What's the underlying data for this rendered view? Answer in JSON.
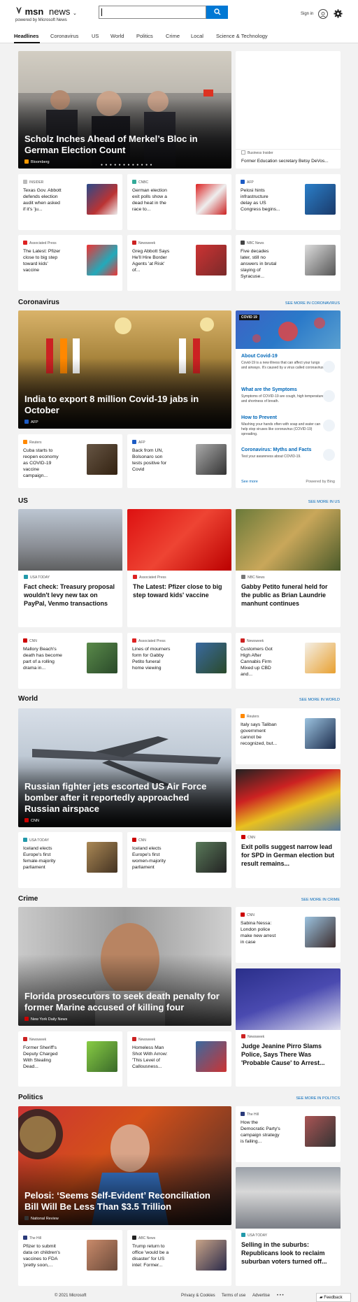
{
  "header": {
    "logo": "msn",
    "product": "news",
    "powered_by": "powered by Microsoft News",
    "search_placeholder": "",
    "signin": "Sign in"
  },
  "nav": [
    "Headlines",
    "Coronavirus",
    "US",
    "World",
    "Politics",
    "Crime",
    "Local",
    "Science & Technology"
  ],
  "headlines": {
    "hero": {
      "title": "Scholz Inches Ahead of Merkel’s Bloc in German Election Count",
      "source": "Bloomberg"
    },
    "side": {
      "source": "Business Insider",
      "title": "Former Education secretary Betsy DeVos..."
    },
    "cards": [
      {
        "source": "INSIDER",
        "title": "Texas Gov. Abbott defends election audit when asked if it's 'ju..."
      },
      {
        "source": "CNBC",
        "title": "German election exit polls show a dead heat in the race to..."
      },
      {
        "source": "AFP",
        "title": "Pelosi hints infrastructure delay as US Congress begins..."
      },
      {
        "source": "Associated Press",
        "title": "The Latest: Pfizer close to big step toward kids' vaccine"
      },
      {
        "source": "Newsweek",
        "title": "Greg Abbott Says He'll Hire Border Agents 'at Risk' of..."
      },
      {
        "source": "NBC News",
        "title": "Five decades later, still no answers in brutal slaying of Syracuse..."
      }
    ]
  },
  "coronavirus": {
    "heading": "Coronavirus",
    "see_more": "SEE MORE IN CORONAVIRUS",
    "hero": {
      "title": "India to export 8 million Covid-19 jabs in October",
      "source": "AFP"
    },
    "cards": [
      {
        "source": "Reuters",
        "title": "Cuba starts to reopen economy as COVID-19 vaccine campaign..."
      },
      {
        "source": "AFP",
        "title": "Back from UN, Bolsonaro son tests positive for Covid"
      }
    ],
    "panel": {
      "tag": "COVID 19",
      "items": [
        {
          "title": "About Covid-19",
          "desc": "Covid-19 is a new illness that can affect your lungs and airways. It's caused by a virus called coronavirus."
        },
        {
          "title": "What are the Symptoms",
          "desc": "Symptoms of COVID-19 are cough, high temperature and shortness of breath."
        },
        {
          "title": "How to Prevent",
          "desc": "Washing your hands often with soap and water can help stop viruses like coronavirus (COVID-19) spreading."
        },
        {
          "title": "Coronavirus: Myths and Facts",
          "desc": "Test your awareness about COVID-19."
        }
      ],
      "see_more": "See more",
      "powered": "Powered by Bing"
    }
  },
  "us": {
    "heading": "US",
    "see_more": "SEE MORE IN US",
    "tall": [
      {
        "source": "USA TODAY",
        "title": "Fact check: Treasury proposal wouldn't levy new tax on PayPal, Venmo transactions"
      },
      {
        "source": "Associated Press",
        "title": "The Latest: Pfizer close to big step toward kids' vaccine"
      },
      {
        "source": "NBC News",
        "title": "Gabby Petito funeral held for the public as Brian Laundrie manhunt continues"
      }
    ],
    "cards": [
      {
        "source": "CNN",
        "title": "Mallory Beach's death has become part of a rolling drama in..."
      },
      {
        "source": "Associated Press",
        "title": "Lines of mourners form for Gabby Petito funeral home viewing"
      },
      {
        "source": "Newsweek",
        "title": "Customers Got High After Cannabis Firm Mixed up CBD and..."
      }
    ]
  },
  "world": {
    "heading": "World",
    "see_more": "SEE MORE IN WORLD",
    "hero": {
      "title": "Russian fighter jets escorted US Air Force bomber after it reportedly approached Russian airspace",
      "source": "CNN"
    },
    "side": {
      "source": "Reuters",
      "title": "Italy says Taliban government cannot be recognized, but..."
    },
    "cards": [
      {
        "source": "USA TODAY",
        "title": "Iceland elects Europe's first female-majority parliament"
      },
      {
        "source": "CNN",
        "title": "Iceland elects Europe's first women-majority parliament"
      }
    ],
    "tall": {
      "source": "CNN",
      "title": "Exit polls suggest narrow lead for SPD in German election but result remains..."
    }
  },
  "crime": {
    "heading": "Crime",
    "see_more": "SEE MORE IN CRIME",
    "hero": {
      "title": "Florida prosecutors to seek death penalty for former Marine accused of killing four",
      "source": "New York Daily News"
    },
    "side": {
      "source": "CNN",
      "title": "Sabina Nessa: London police make new arrest in case"
    },
    "cards": [
      {
        "source": "Newsweek",
        "title": "Former Sheriff's Deputy Charged With Stealing Dead..."
      },
      {
        "source": "Newsweek",
        "title": "Homeless Man Shot With Arrow: 'This Level of Callousness..."
      }
    ],
    "tall": {
      "source": "Newsweek",
      "title": "Judge Jeanine Pirro Slams Police, Says There Was 'Probable Cause' to Arrest..."
    }
  },
  "politics": {
    "heading": "Politics",
    "see_more": "SEE MORE IN POLITICS",
    "hero": {
      "title": "Pelosi: ‘Seems Self-Evident’ Reconciliation Bill Will Be Less Than $3.5 Trillion",
      "source": "National Review"
    },
    "side": {
      "source": "The Hill",
      "title": "How the Democratic Party's campaign strategy is failing..."
    },
    "cards": [
      {
        "source": "The Hill",
        "title": "Pfizer to submit data on children's vaccines to FDA 'pretty soon,..."
      },
      {
        "source": "ABC News",
        "title": "Trump return to office 'would be a disaster' for US intel: Former..."
      }
    ],
    "tall": {
      "source": "USA TODAY",
      "title": "Selling in the suburbs: Republicans look to reclaim suburban voters turned off..."
    }
  },
  "footer": {
    "copyright": "© 2021 Microsoft",
    "links": [
      "Privacy & Cookies",
      "Terms of use",
      "Advertise"
    ],
    "more": "• • •",
    "feedback": "Feedback"
  },
  "colors": {
    "accent": "#0078d4",
    "link": "#0067b8",
    "background": "#f2f2f2"
  }
}
